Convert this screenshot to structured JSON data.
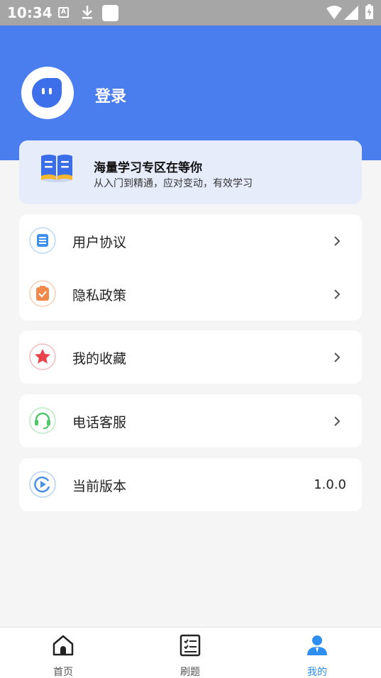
{
  "status_bar": {
    "time": "10:34",
    "notif_letter": "A"
  },
  "header": {
    "login_label": "登录"
  },
  "promo": {
    "title": "海量学习专区在等你",
    "subtitle": "从入门到精通，应对变动，有效学习"
  },
  "menu": {
    "user_agreement": "用户协议",
    "privacy_policy": "隐私政策",
    "favorites": "我的收藏",
    "customer_service": "电话客服",
    "version_label": "当前版本",
    "version_value": "1.0.0"
  },
  "tabs": [
    {
      "label": "首页",
      "icon": "home-icon",
      "active": false
    },
    {
      "label": "刷题",
      "icon": "checklist-icon",
      "active": false
    },
    {
      "label": "我的",
      "icon": "person-icon",
      "active": true
    }
  ],
  "colors": {
    "header_blue": "#4a7dee",
    "active_tab": "#2e8ff0",
    "agreement_icon": "#3b8ff0",
    "privacy_icon": "#f08a4b",
    "favorites_icon": "#e9434b",
    "service_icon": "#4ec86a",
    "version_icon": "#4a8fe8"
  }
}
